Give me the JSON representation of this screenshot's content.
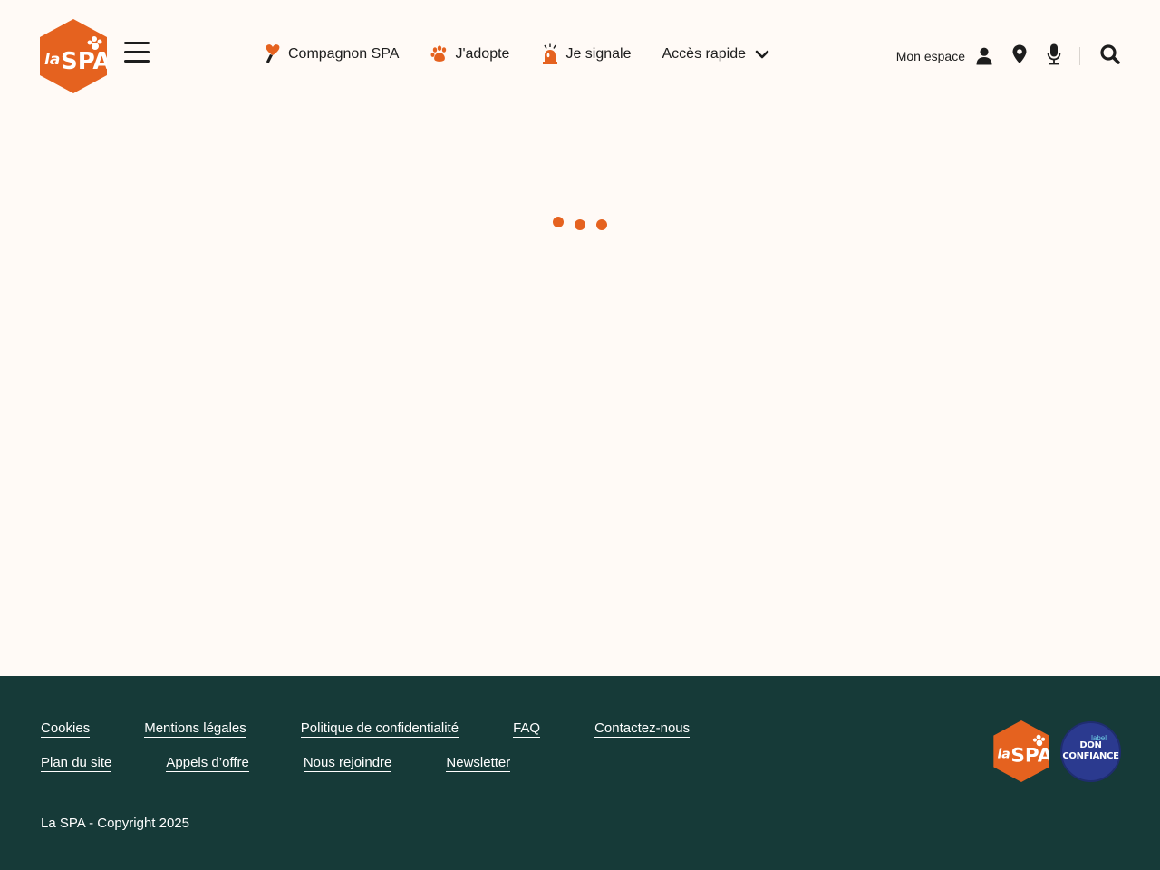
{
  "header": {
    "nav": [
      {
        "label": "Compagnon SPA",
        "icon": "heart-pen-icon"
      },
      {
        "label": "J'adopte",
        "icon": "paw-icon"
      },
      {
        "label": "Je signale",
        "icon": "alarm-light-icon"
      },
      {
        "label": "Accès rapide",
        "icon": "chevron-down-icon"
      }
    ],
    "account_label": "Mon espace",
    "tools": [
      "user-icon",
      "map-pin-icon",
      "microphone-icon",
      "search-icon"
    ]
  },
  "loader": {
    "state": "loading",
    "dots": 3
  },
  "footer": {
    "row1": [
      "Cookies",
      "Mentions légales",
      "Politique de confidentialité",
      "FAQ",
      "Contactez-nous"
    ],
    "row2": [
      "Plan du site",
      "Appels d’offre",
      "Nous rejoindre",
      "Newsletter"
    ],
    "copyright": "La SPA - Copyright 2025",
    "badge": {
      "small": "label",
      "line1": "DON",
      "line2": "CONFIANCE"
    }
  },
  "colors": {
    "accent": "#e5621f",
    "footer_bg": "#163a38",
    "page_bg": "#fffaf6",
    "badge_bg": "#2b3a8f"
  }
}
